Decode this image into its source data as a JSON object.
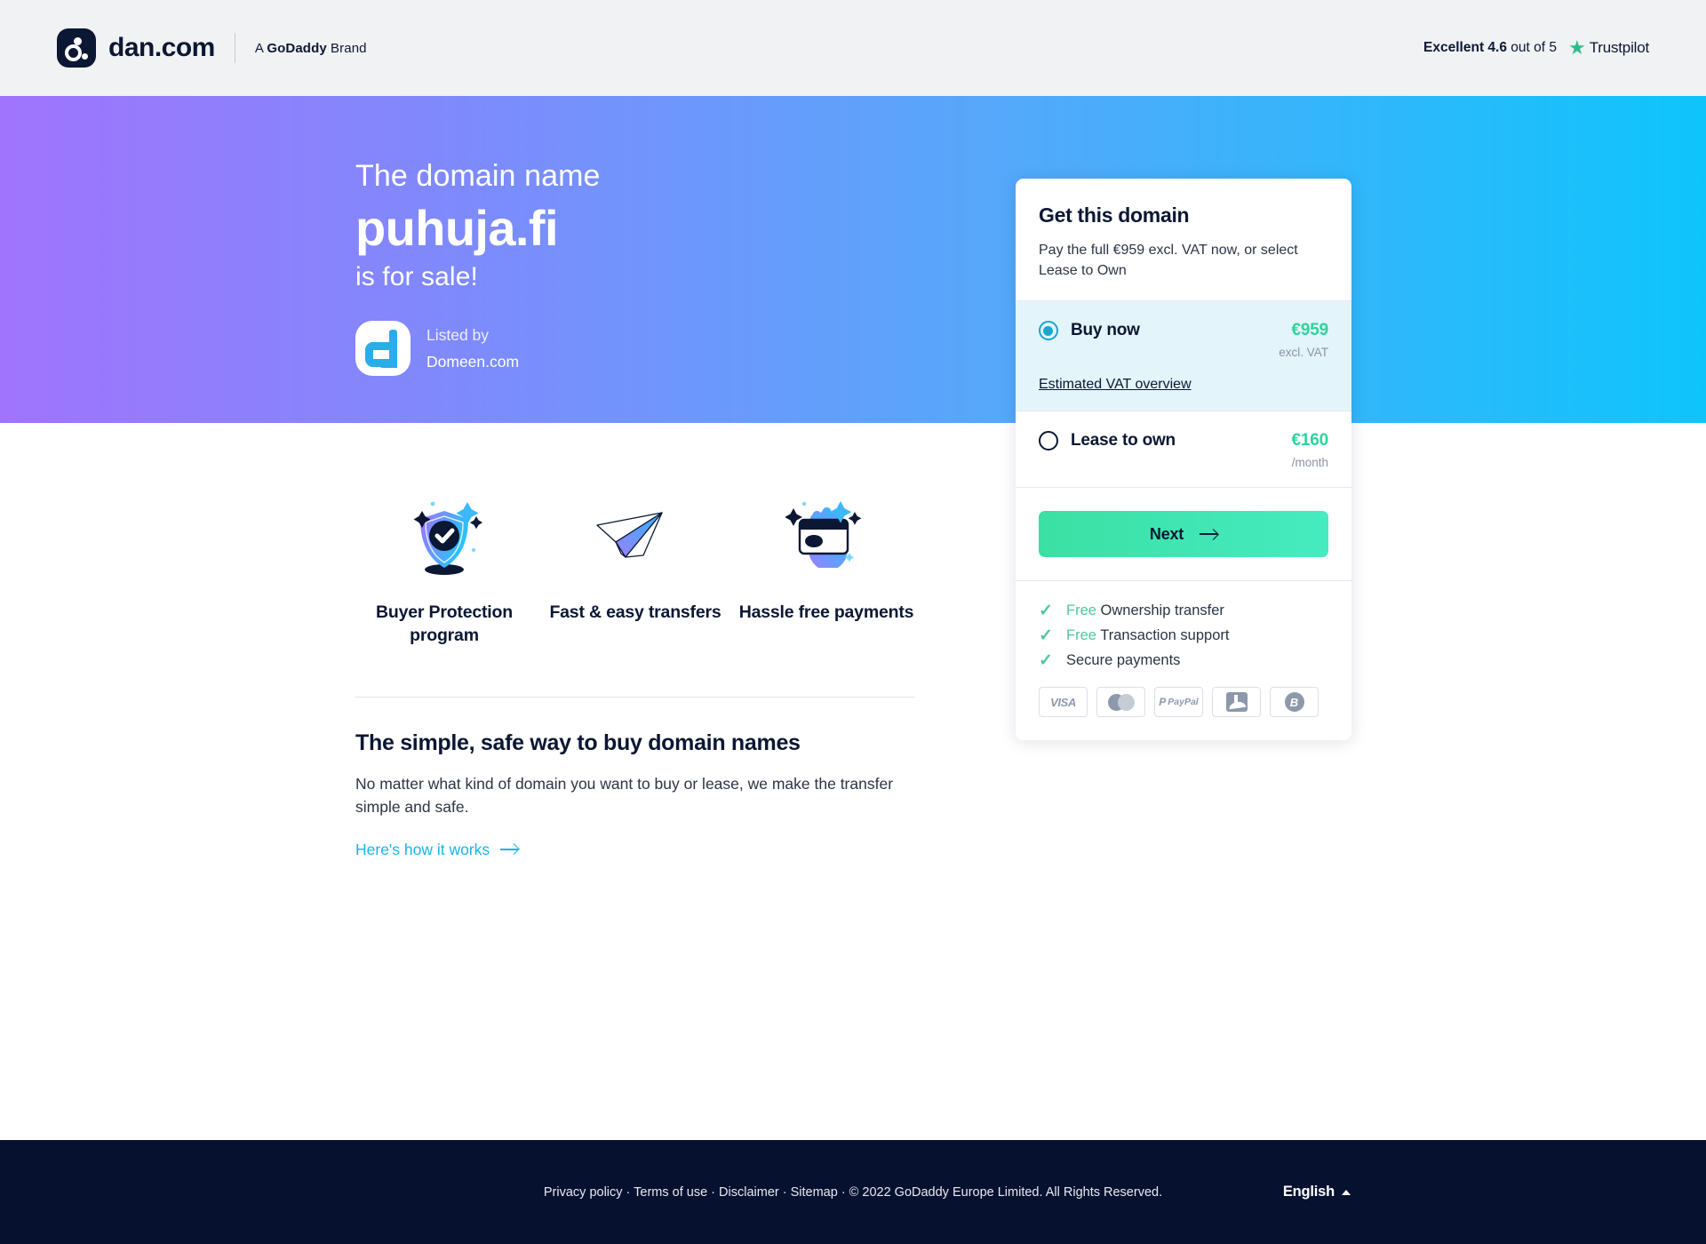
{
  "header": {
    "brand_name": "dan.com",
    "brand_sub_prefix": "A ",
    "brand_sub_bold": "GoDaddy",
    "brand_sub_suffix": " Brand",
    "trust_prefix": "Excellent 4.6",
    "trust_suffix": " out of 5",
    "trust_logo_word": "Trustpilot",
    "trust_star": "★"
  },
  "hero": {
    "line1": "The domain name",
    "domain": "puhuja.fi",
    "line3": "is for sale!",
    "listed_label": "Listed by",
    "listed_name": "Domeen.com"
  },
  "features": [
    {
      "icon": "shield-check-icon",
      "label": "Buyer Protection program"
    },
    {
      "icon": "paper-plane-icon",
      "label": "Fast & easy transfers"
    },
    {
      "icon": "card-hand-icon",
      "label": "Hassle free payments"
    }
  ],
  "info": {
    "heading": "The simple, safe way to buy domain names",
    "body": "No matter what kind of domain you want to buy or lease, we make the transfer simple and safe.",
    "link": "Here's how it works"
  },
  "card": {
    "title": "Get this domain",
    "subtitle": "Pay the full €959 excl. VAT now, or select Lease to Own",
    "options": [
      {
        "name": "Buy now",
        "price": "€959",
        "note": "excl. VAT",
        "selected": true,
        "sub_link": "Estimated VAT overview"
      },
      {
        "name": "Lease to own",
        "price": "€160",
        "note": "/month",
        "selected": false,
        "sub_link": ""
      }
    ],
    "next_label": "Next",
    "perks": [
      {
        "free": "Free",
        "text": "Ownership transfer"
      },
      {
        "free": "Free",
        "text": "Transaction support"
      },
      {
        "free": "",
        "text": "Secure payments"
      }
    ],
    "payments": [
      "VISA",
      "mastercard-icon",
      "PayPal",
      "alipay-icon",
      "bitcoin-icon"
    ]
  },
  "footer": {
    "links_text": "Privacy policy · Terms of use · Disclaimer · Sitemap · © 2022 GoDaddy Europe Limited. All Rights Reserved.",
    "language": "English"
  },
  "colors": {
    "hero_gradient_start": "#a074fd",
    "hero_gradient_end": "#0ec5fb",
    "accent_green": "#2fd39b",
    "accent_cyan": "#17b5e8",
    "dark_navy": "#0b1733",
    "footer_bg": "#061130",
    "selected_option_bg": "#e4f4fb"
  }
}
